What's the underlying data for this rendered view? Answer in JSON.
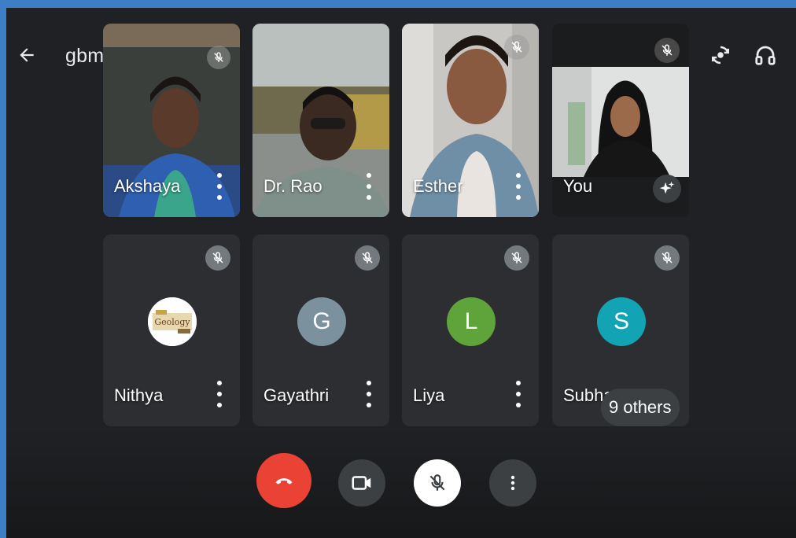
{
  "meeting": {
    "code": "gbm-awae-wxq"
  },
  "colors": {
    "end_call": "#ea4335",
    "avatar_gayathri": "#7b929e",
    "avatar_liya": "#5fa33b",
    "avatar_subha": "#12a4b5"
  },
  "participants_video": [
    {
      "name": "Akshaya"
    },
    {
      "name": "Dr. Rao"
    },
    {
      "name": "Esther"
    },
    {
      "name": "You"
    }
  ],
  "participants_audio": [
    {
      "name": "Nithya",
      "avatar_text": "Geology"
    },
    {
      "name": "Gayathri",
      "avatar_letter": "G"
    },
    {
      "name": "Liya",
      "avatar_letter": "L"
    },
    {
      "name": "Subha",
      "avatar_letter": "S",
      "others_label": "9 others"
    }
  ],
  "icons": {
    "back": "arrow-left-icon",
    "switch_camera": "switch-camera-icon",
    "audio_output": "headphones-icon",
    "mic_off": "mic-off-icon",
    "more": "more-vertical-icon",
    "effects": "sparkle-icon",
    "end_call": "phone-hangup-icon",
    "camera": "videocam-icon"
  }
}
